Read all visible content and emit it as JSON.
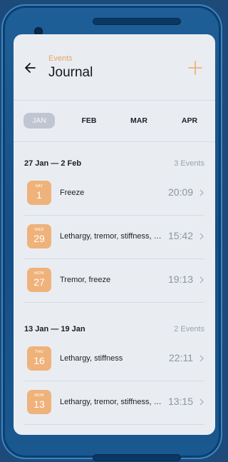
{
  "header": {
    "subtitle": "Events",
    "title": "Journal"
  },
  "months": [
    "JAN",
    "FEB",
    "MAR",
    "APR"
  ],
  "active_month": "JAN",
  "groups": [
    {
      "range": "27 Jan — 2 Feb",
      "count": "3 Events",
      "events": [
        {
          "dow": "SAT",
          "day": "1",
          "desc": "Freeze",
          "time": "20:09"
        },
        {
          "dow": "WED",
          "day": "29",
          "desc": "Lethargy, tremor, stiffness, …",
          "time": "15:42"
        },
        {
          "dow": "MON",
          "day": "27",
          "desc": "Tremor, freeze",
          "time": "19:13"
        }
      ]
    },
    {
      "range": "13 Jan — 19 Jan",
      "count": "2 Events",
      "events": [
        {
          "dow": "THU",
          "day": "16",
          "desc": "Lethargy, stiffness",
          "time": "22:11"
        },
        {
          "dow": "MON",
          "day": "13",
          "desc": "Lethargy, tremor, stiffness, …",
          "time": "13:15"
        }
      ]
    }
  ],
  "colors": {
    "accent": "#efb27a",
    "subtitle": "#e9a563",
    "screen_bg": "#e9edf2",
    "device": "#1f5f97"
  },
  "icons": {
    "back": "arrow-left-icon",
    "add": "plus-icon",
    "row": "chevron-right-icon"
  }
}
